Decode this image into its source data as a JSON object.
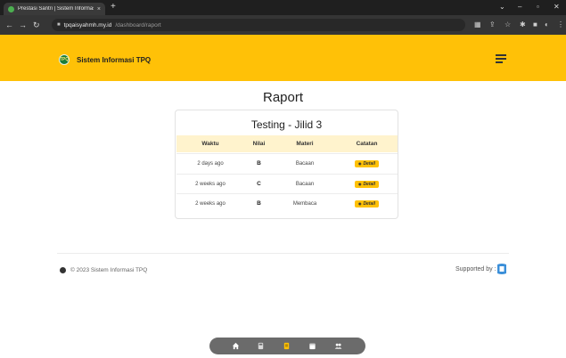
{
  "browser": {
    "tab_title": "Prestasi Santri | Sistem Informasi",
    "tab_close": "×",
    "new_tab": "+",
    "url_host": "tpqaisyahmh.my.id",
    "url_path": "/dashboard/raport"
  },
  "header": {
    "brand": "Sistem Informasi TPQ",
    "logo_text": "TPQ"
  },
  "page": {
    "title": "Raport"
  },
  "card": {
    "title": "Testing - Jilid 3",
    "columns": [
      "Waktu",
      "Nilai",
      "Materi",
      "Catatan"
    ],
    "rows": [
      {
        "waktu": "2 days ago",
        "nilai": "B",
        "materi": "Bacaan",
        "catatan": "Detail"
      },
      {
        "waktu": "2 weeks ago",
        "nilai": "C",
        "materi": "Bacaan",
        "catatan": "Detail"
      },
      {
        "waktu": "2 weeks ago",
        "nilai": "B",
        "materi": "Membaca",
        "catatan": "Detail"
      }
    ]
  },
  "footer": {
    "copyright": "© 2023 Sistem Informasi TPQ",
    "supported": "Supported by :"
  },
  "colors": {
    "accent": "#ffc107",
    "table_header": "#fff3cd",
    "logo_green": "#1b7d3a"
  },
  "icons": {
    "dock": [
      "home-icon",
      "calculator-icon",
      "report-icon",
      "calendar-icon",
      "users-icon"
    ]
  }
}
